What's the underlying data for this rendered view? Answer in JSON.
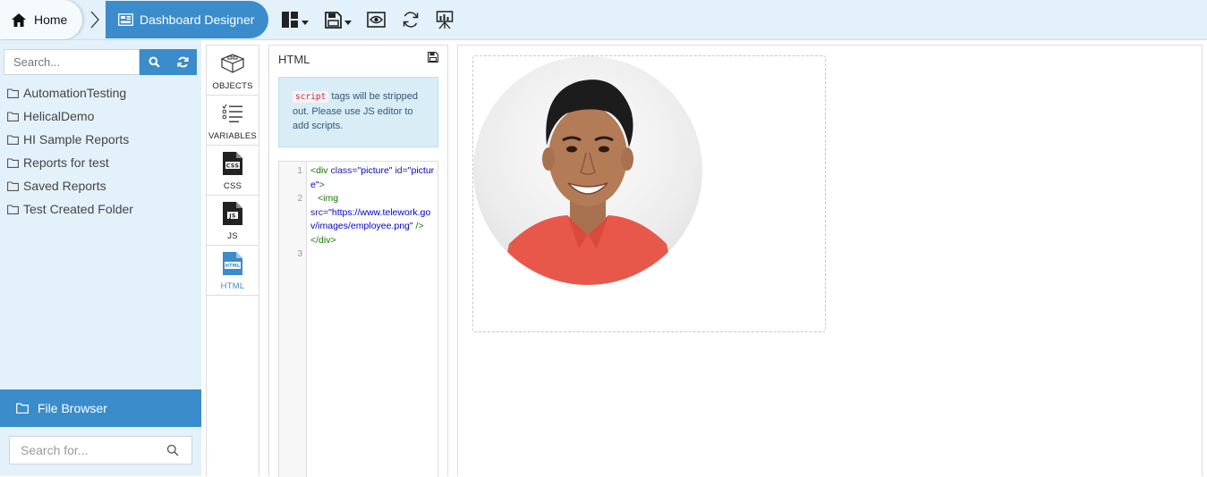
{
  "breadcrumb": {
    "home_label": "Home",
    "current_label": "Dashboard Designer"
  },
  "toolbar": {
    "icons": [
      "layout-icon",
      "save-icon",
      "preview-icon",
      "refresh-icon",
      "present-icon"
    ]
  },
  "sidebar": {
    "search_placeholder": "Search...",
    "folders": [
      {
        "label": "AutomationTesting"
      },
      {
        "label": "HelicalDemo"
      },
      {
        "label": "HI Sample Reports"
      },
      {
        "label": "Reports for test"
      },
      {
        "label": "Saved Reports"
      },
      {
        "label": "Test Created Folder"
      }
    ],
    "file_browser_label": "File Browser",
    "search_for_placeholder": "Search for..."
  },
  "palette": {
    "items": [
      {
        "label": "OBJECTS",
        "icon": "objects-icon"
      },
      {
        "label": "VARIABLES",
        "icon": "variables-icon"
      },
      {
        "label": "CSS",
        "icon": "css-file-icon"
      },
      {
        "label": "JS",
        "icon": "js-file-icon"
      },
      {
        "label": "HTML",
        "icon": "html-file-icon",
        "active": true
      }
    ]
  },
  "editor": {
    "title": "HTML",
    "notice_code": "script",
    "notice_text": "tags will be stripped out. Please use JS editor to add scripts.",
    "line_numbers": [
      "1",
      "2",
      "3"
    ],
    "code": {
      "l1_open": "<div",
      "l1_attr1": "class=",
      "l1_val1": "\"picture\"",
      "l1_attr2": "id=",
      "l1_val2": "\"picture\"",
      "l1_close": ">",
      "l2_open": "<img",
      "l2_attr": "src=",
      "l2_val": "\"https://www.telework.gov/images/employee.png\"",
      "l2_close": "/>",
      "l3": "</div>"
    }
  },
  "colors": {
    "accent": "#3a8ccb",
    "sidebar_bg": "#e3f1fa",
    "notice_bg": "#d9edf7"
  }
}
